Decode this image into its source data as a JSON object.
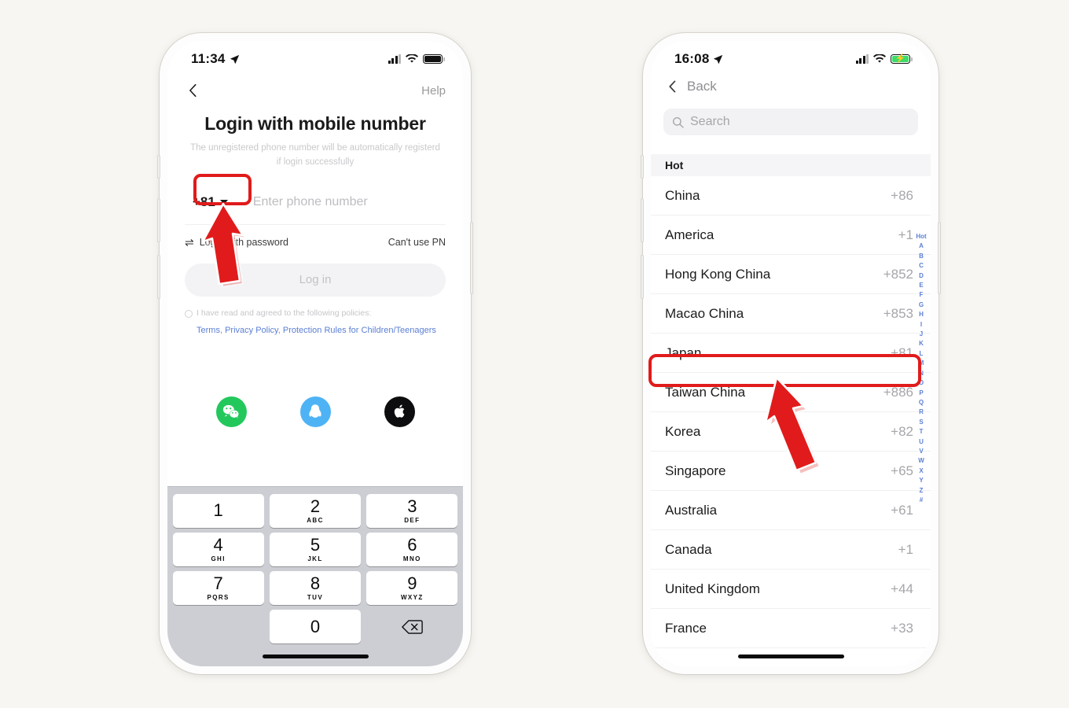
{
  "background_color": "#f7f6f2",
  "accent_color": "#e11b1b",
  "link_color": "#5b7fd4",
  "left_phone": {
    "status_bar": {
      "time": "11:34",
      "location_icon": "location-arrow-icon",
      "signal_icon": "cellular-signal-icon",
      "wifi_icon": "wifi-icon",
      "battery_icon": "battery-full-icon",
      "battery_charging": false
    },
    "nav": {
      "back_icon": "chevron-left-icon",
      "help_label": "Help"
    },
    "title": "Login with mobile number",
    "subtitle": "The unregistered phone number will be automatically registerd if login successfully",
    "country_code": {
      "value": "+81",
      "caret_icon": "caret-down-icon"
    },
    "phone_input": {
      "value": "",
      "placeholder": "Enter phone number"
    },
    "alt_row": {
      "swap_icon": "swap-arrows-icon",
      "password_login_label": "Login with password",
      "cant_use_label": "Can't use PN"
    },
    "login_button_label": "Log in",
    "policy": {
      "checkbox_icon": "radio-unchecked-icon",
      "agree_text": "I have read and agreed to the following policies:",
      "links": [
        "Terms",
        "Privacy Policy",
        "Protection Rules for Children/Teenagers"
      ],
      "separator": ","
    },
    "socials": [
      {
        "name": "wechat-login-button",
        "icon": "wechat-icon",
        "color": "#23c85c"
      },
      {
        "name": "qq-login-button",
        "icon": "qq-penguin-icon",
        "color": "#4eb3f5"
      },
      {
        "name": "apple-login-button",
        "icon": "apple-icon",
        "color": "#0d0d0f"
      }
    ],
    "keypad": [
      [
        {
          "num": "1",
          "letters": ""
        },
        {
          "num": "2",
          "letters": "ABC"
        },
        {
          "num": "3",
          "letters": "DEF"
        }
      ],
      [
        {
          "num": "4",
          "letters": "GHI"
        },
        {
          "num": "5",
          "letters": "JKL"
        },
        {
          "num": "6",
          "letters": "MNO"
        }
      ],
      [
        {
          "num": "7",
          "letters": "PQRS"
        },
        {
          "num": "8",
          "letters": "TUV"
        },
        {
          "num": "9",
          "letters": "WXYZ"
        }
      ]
    ],
    "keypad_zero": {
      "num": "0",
      "letters": ""
    },
    "keypad_delete_icon": "backspace-delete-icon"
  },
  "right_phone": {
    "status_bar": {
      "time": "16:08",
      "location_icon": "location-arrow-icon",
      "signal_icon": "cellular-signal-icon",
      "wifi_icon": "wifi-icon",
      "battery_icon": "battery-charging-icon",
      "battery_charging": true
    },
    "nav": {
      "back_icon": "chevron-left-icon",
      "back_label": "Back"
    },
    "search": {
      "icon": "search-icon",
      "value": "",
      "placeholder": "Search"
    },
    "section_header": "Hot",
    "countries": [
      {
        "name": "China",
        "code": "+86"
      },
      {
        "name": "America",
        "code": "+1"
      },
      {
        "name": "Hong Kong China",
        "code": "+852"
      },
      {
        "name": "Macao China",
        "code": "+853"
      },
      {
        "name": "Japan",
        "code": "+81",
        "highlighted": true
      },
      {
        "name": "Taiwan China",
        "code": "+886"
      },
      {
        "name": "Korea",
        "code": "+82"
      },
      {
        "name": "Singapore",
        "code": "+65"
      },
      {
        "name": "Australia",
        "code": "+61"
      },
      {
        "name": "Canada",
        "code": "+1"
      },
      {
        "name": "United Kingdom",
        "code": "+44"
      },
      {
        "name": "France",
        "code": "+33"
      }
    ],
    "alphabet_index": [
      "Hot",
      "A",
      "B",
      "C",
      "D",
      "E",
      "F",
      "G",
      "H",
      "I",
      "J",
      "K",
      "L",
      "M",
      "N",
      "O",
      "P",
      "Q",
      "R",
      "S",
      "T",
      "U",
      "V",
      "W",
      "X",
      "Y",
      "Z",
      "#"
    ]
  },
  "annotations": [
    {
      "name": "country-code-highlight",
      "target": "+81 selector"
    },
    {
      "name": "country-code-arrow",
      "target": "+81 selector"
    },
    {
      "name": "japan-row-highlight",
      "target": "Japan +81 row"
    },
    {
      "name": "japan-row-arrow",
      "target": "Japan +81 row"
    }
  ]
}
